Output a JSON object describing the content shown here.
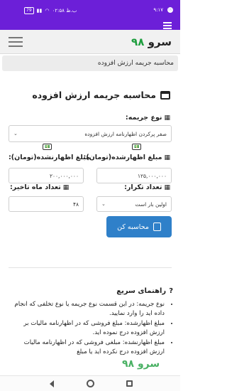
{
  "status_bar": {
    "battery": "79",
    "time_left": "۰۲:۵۸ ب.ظ",
    "time_right": "۹:۱۷"
  },
  "navbar": {
    "brand_text": "سرو",
    "brand_number": "۹۸"
  },
  "breadcrumb": "محاسبه جریمه ارزش افزوده",
  "card": {
    "title": "محاسبه جریمه ارزش افزوده"
  },
  "form": {
    "penalty_type_label": "نوع جریمه:",
    "penalty_type_value": "صفر پرکردن اظهارنامه ارزش افزوده",
    "declared_amount_label": "مبلغ اظهارشده(تومان):",
    "declared_amount_value": "۱۲۵,۰۰۰,۰۰۰",
    "undeclared_amount_label": "مبلغ اظهارنشده(تومان):",
    "undeclared_amount_value": "۲۰۰,۰۰۰,۰۰۰",
    "repeat_count_label": "تعداد تکرار:",
    "repeat_count_value": "اولین بار است",
    "delay_months_label": "تعداد ماه تاخیر:",
    "delay_months_value": "۴۸",
    "calculate_button": "محاسبه کن"
  },
  "quick_guide": {
    "title": "راهنمای سریع",
    "items": [
      "نوع جریمه: در این قسمت نوع جریمه یا نوع تخلفی که انجام داده اید را وارد نمایید.",
      "مبلغ اظهارشده: مبلغ فروشی که در اظهارنامه مالیات بر ارزش افزوده درج نموده اید.",
      "مبلغ اظهارنشده: مبلغی فروشی که در اظهارنامه مالیات ارزش افزوده درج نکرده اید یا مبلغ"
    ]
  },
  "watermark": "سرو ۹۸"
}
